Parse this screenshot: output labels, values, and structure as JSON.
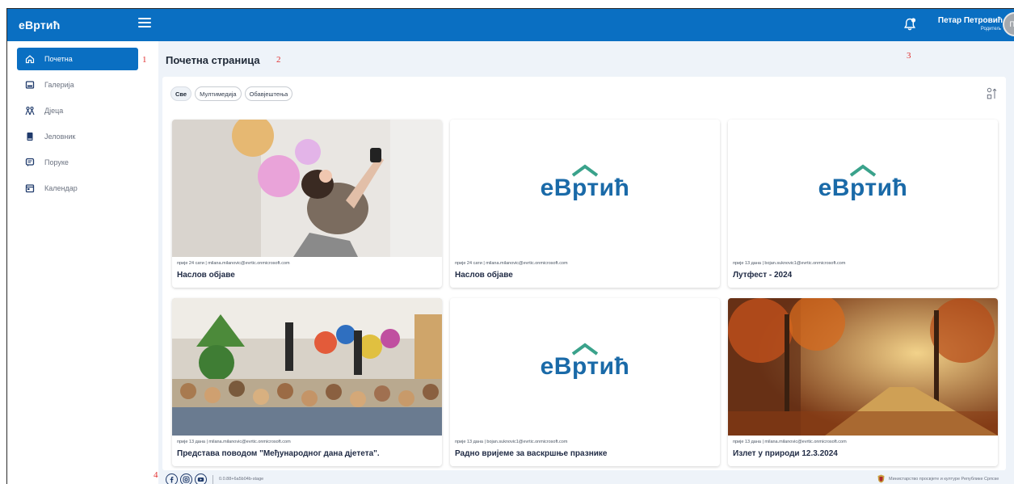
{
  "header": {
    "logo_text": "еВртић",
    "user_name": "Петар Петровић",
    "user_role": "Родитељ",
    "avatar_initials": "ПП"
  },
  "sidebar": {
    "items": [
      {
        "label": "Почетна",
        "icon": "home-icon"
      },
      {
        "label": "Галерија",
        "icon": "gallery-icon"
      },
      {
        "label": "Дјеца",
        "icon": "children-icon"
      },
      {
        "label": "Јеловник",
        "icon": "menu-book-icon"
      },
      {
        "label": "Поруке",
        "icon": "messages-icon"
      },
      {
        "label": "Календар",
        "icon": "calendar-icon"
      }
    ]
  },
  "annotations": [
    "1",
    "2",
    "3",
    "4"
  ],
  "main": {
    "page_title": "Почетна страница",
    "filters": [
      "Све",
      "Мултимедија",
      "Обавјештења"
    ]
  },
  "posts": [
    {
      "meta": "прије 24 сати | milana.milanovic@evrtic.onmicrosoft.com",
      "title": "Наслов објаве",
      "image": "photo-party"
    },
    {
      "meta": "прије 24 сати | milana.milanovic@evrtic.onmicrosoft.com",
      "title": "Наслов објаве",
      "image": "logo"
    },
    {
      "meta": "прије 13 дана | bojan.suknovic1@evrtic.onmicrosoft.com",
      "title": "Лутфест - 2024",
      "image": "logo"
    },
    {
      "meta": "прије 13 дана | milana.milanovic@evrtic.onmicrosoft.com",
      "title": "Представа поводом \"Међународног дана дјетета\".",
      "image": "photo-theatre"
    },
    {
      "meta": "прије 13 дана | bojan.suknovic1@evrtic.onmicrosoft.com",
      "title": "Радно вријеме за васкршње празнике",
      "image": "logo"
    },
    {
      "meta": "прије 13 дана | milana.milanovic@evrtic.onmicrosoft.com",
      "title": "Излет у природи 12.3.2024",
      "image": "photo-forest"
    }
  ],
  "footer": {
    "version": "0.0.88+6a5b04b-stage",
    "ministry": "Министарство просвјете и културе Републике Српске"
  },
  "colors": {
    "primary": "#0a6fc2",
    "title_text": "#1f2a44",
    "background": "#eef3f9"
  }
}
